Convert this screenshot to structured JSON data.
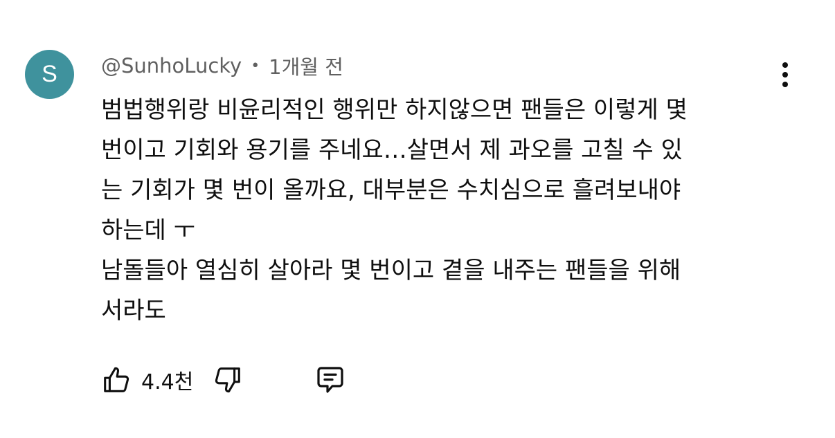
{
  "comment": {
    "avatar_initial": "S",
    "avatar_color": "#3f929d",
    "author": "@SunhoLucky",
    "separator": "•",
    "time": "1개월 전",
    "lines": [
      "범법행위랑 비윤리적인 행위만 하지않으면 팬들은 이렇게 몇",
      "번이고 기회와 용기를 주네요…살면서 제 과오를 고칠 수 있",
      "는 기회가 몇 번이 올까요, 대부분은 수치심으로 흘려보내야",
      "하는데 ㅜ",
      "남돌들아 열심히 살아라 몇 번이고 곁을 내주는 팬들을 위해",
      "서라도"
    ],
    "like_count": "4.4천",
    "icons": {
      "like": "thumbs-up-icon",
      "dislike": "thumbs-down-icon",
      "reply": "comment-reply-icon",
      "menu": "more-vertical-icon"
    }
  }
}
